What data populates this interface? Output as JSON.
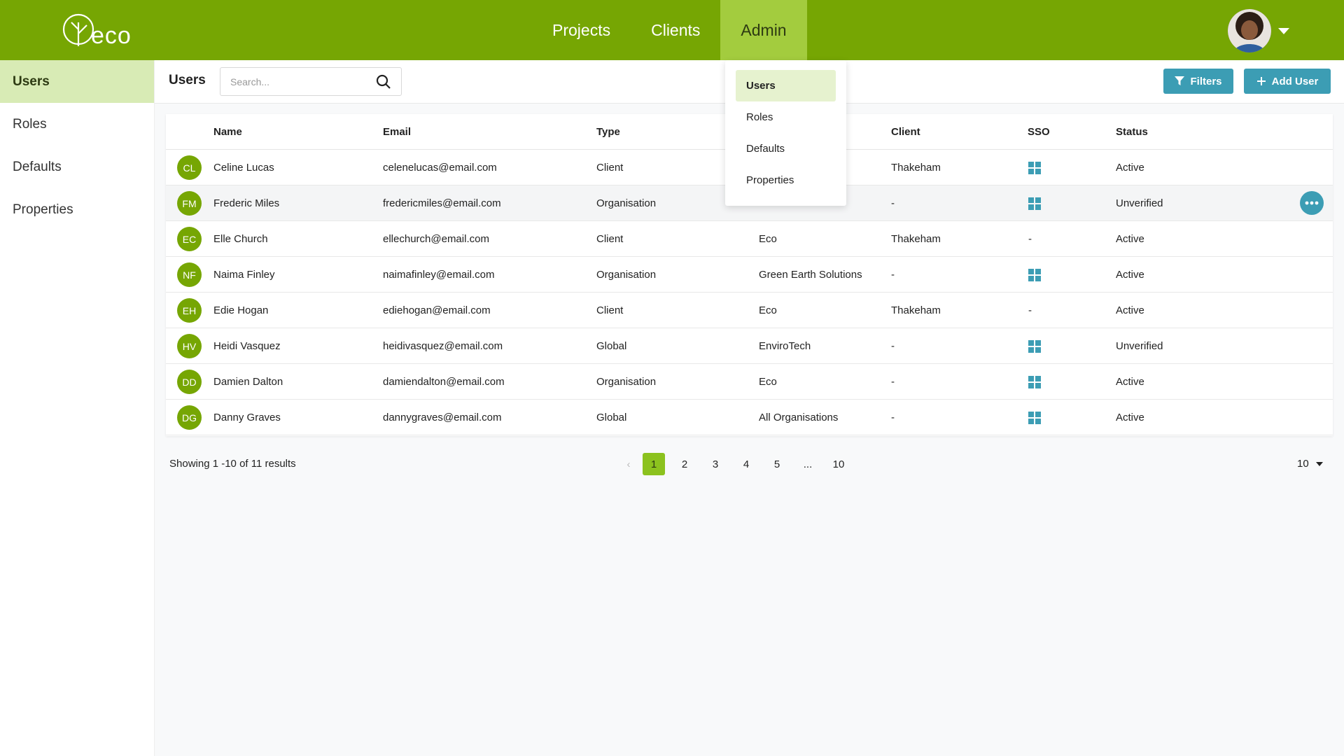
{
  "app": {
    "logo_text": "eco"
  },
  "nav": {
    "items": [
      {
        "label": "Projects"
      },
      {
        "label": "Clients"
      },
      {
        "label": "Admin"
      }
    ]
  },
  "sidebar": {
    "items": [
      {
        "label": "Users"
      },
      {
        "label": "Roles"
      },
      {
        "label": "Defaults"
      },
      {
        "label": "Properties"
      }
    ]
  },
  "toolbar": {
    "title": "Users",
    "search_placeholder": "Search...",
    "filters_label": "Filters",
    "add_user_label": "Add User"
  },
  "admin_menu": {
    "items": [
      {
        "label": "Users"
      },
      {
        "label": "Roles"
      },
      {
        "label": "Defaults"
      },
      {
        "label": "Properties"
      }
    ]
  },
  "table": {
    "headers": {
      "name": "Name",
      "email": "Email",
      "type": "Type",
      "client": "Client",
      "sso": "SSO",
      "status": "Status"
    },
    "rows": [
      {
        "initials": "CL",
        "name": "Celine Lucas",
        "email": "celenelucas@email.com",
        "type": "Client",
        "org": "",
        "client": "Thakeham",
        "sso": "windows",
        "status": "Active"
      },
      {
        "initials": "FM",
        "name": "Frederic Miles",
        "email": "fredericmiles@email.com",
        "type": "Organisation",
        "org": "",
        "client": "-",
        "sso": "windows",
        "status": "Unverified"
      },
      {
        "initials": "EC",
        "name": "Elle Church",
        "email": "ellechurch@email.com",
        "type": "Client",
        "org": "Eco",
        "client": "Thakeham",
        "sso": "-",
        "status": "Active"
      },
      {
        "initials": "NF",
        "name": "Naima Finley",
        "email": "naimafinley@email.com",
        "type": "Organisation",
        "org": "Green Earth Solutions",
        "client": "-",
        "sso": "windows",
        "status": "Active"
      },
      {
        "initials": "EH",
        "name": "Edie Hogan",
        "email": "ediehogan@email.com",
        "type": "Client",
        "org": "Eco",
        "client": "Thakeham",
        "sso": "-",
        "status": "Active"
      },
      {
        "initials": "HV",
        "name": "Heidi Vasquez",
        "email": "heidivasquez@email.com",
        "type": "Global",
        "org": "EnviroTech",
        "client": "-",
        "sso": "windows",
        "status": "Unverified"
      },
      {
        "initials": "DD",
        "name": "Damien Dalton",
        "email": "damiendalton@email.com",
        "type": "Organisation",
        "org": "Eco",
        "client": "-",
        "sso": "windows",
        "status": "Active"
      },
      {
        "initials": "DG",
        "name": "Danny Graves",
        "email": "dannygraves@email.com",
        "type": "Global",
        "org": "All Organisations",
        "client": "-",
        "sso": "windows",
        "status": "Active"
      }
    ]
  },
  "pagination": {
    "showing_text": "Showing 1 -10 of 11 results",
    "pages": [
      "1",
      "2",
      "3",
      "4",
      "5",
      "...",
      "10"
    ],
    "prev_symbol": "‹",
    "per_page": "10"
  },
  "colors": {
    "brand_green": "#76a603",
    "accent_teal": "#3c9db4",
    "active_light": "#d8ebb5"
  }
}
